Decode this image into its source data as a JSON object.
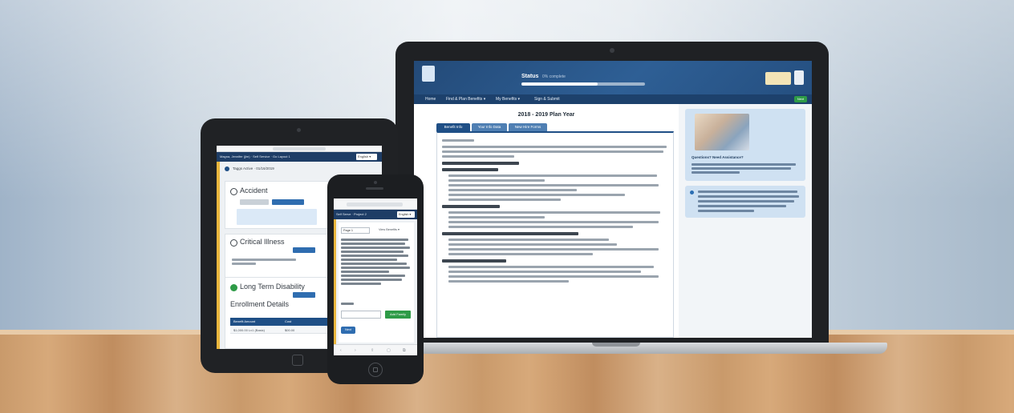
{
  "laptop": {
    "status_label": "Status",
    "status_sub": "0% complete",
    "progress_fraction": 0.62,
    "nav": [
      "Home",
      "Find & Plan Benefits ▾",
      "My Benefits ▾",
      "Sign & Submit"
    ],
    "nav_pill": "Next",
    "page_title": "2018 - 2019 Plan Year",
    "tabs": [
      "Benefit Info",
      "Your Info Data",
      "New Hire Forms"
    ],
    "side_question": "Questions? Need Assistance?",
    "colors": {
      "header": "#2e5f95",
      "nav": "#1d416c",
      "accent_green": "#2e9b47",
      "side_panel": "#cfe1f2"
    }
  },
  "tablet": {
    "top_text": "Magna, Jennifer (jlm) · Self Service · Go Layout 1",
    "language": "English ▾",
    "user_text": "Taggs    Active · 01/16/2019",
    "cards": {
      "accident": "Accident",
      "critical_illness": "Critical Illness",
      "ltd": "Long Term Disability"
    },
    "enrollment_details": "Enrollment Details",
    "table_headers": [
      "Benefit Amount",
      "Cost"
    ],
    "table_row": [
      "$1,000.00 Lv1 (Basic)",
      "$00.00"
    ],
    "colors": {
      "accent": "#e9b63d",
      "primary": "#1f4f86",
      "success": "#2e9b47"
    }
  },
  "phone": {
    "head_text": "Self Serve · Project 2",
    "language": "English ▾",
    "select_value": "Page 1",
    "view_text": "View Benefits ▾",
    "green_button": "Add Family",
    "next_button": "Next",
    "colors": {
      "accent": "#e9b63d",
      "button": "#2f6db0"
    }
  }
}
